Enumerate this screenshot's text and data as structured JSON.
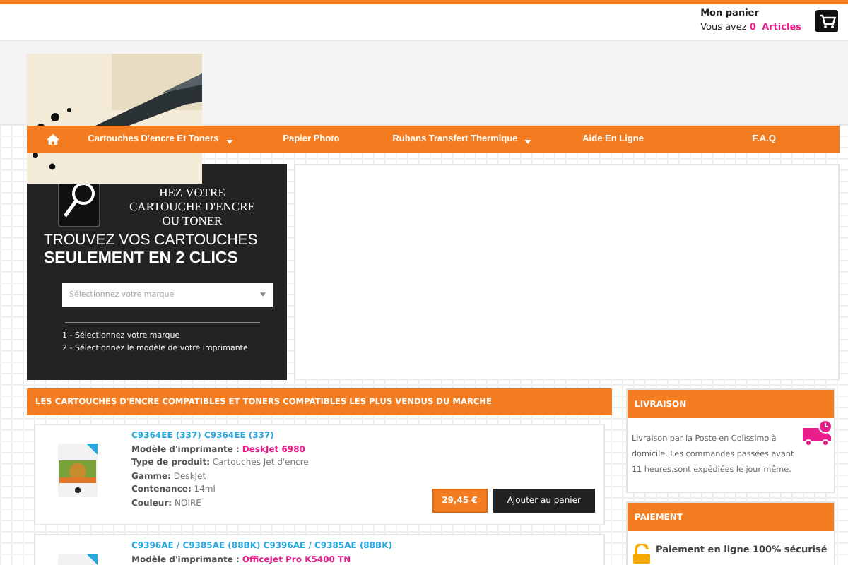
{
  "cart": {
    "title": "Mon panier",
    "prefix": "Vous avez",
    "count": "0",
    "label": "Articles"
  },
  "nav": {
    "items": [
      {
        "kind": "home"
      },
      {
        "kind": "link",
        "label": "Cartouches D'encre Et Toners",
        "dropdown": true
      },
      {
        "kind": "link",
        "label": "Papier Photo",
        "dropdown": false
      },
      {
        "kind": "link",
        "label": "Rubans Transfert Thermique",
        "dropdown": true
      },
      {
        "kind": "link",
        "label": "Aide En Ligne",
        "dropdown": false
      },
      {
        "kind": "link",
        "label": "F.A.Q",
        "dropdown": false
      }
    ]
  },
  "finder": {
    "heading_lines": [
      "HEZ VOTRE",
      "CARTOUCHE D'ENCRE",
      "OU TONER"
    ],
    "title": "TROUVEZ VOS CARTOUCHES",
    "subtitle": "SEULEMENT EN 2 CLICS",
    "select": {
      "placeholder": "Sélectionnez votre marque"
    },
    "steps": [
      "1 - Sélectionnez votre marque",
      "2 - Sélectionnez le modèle de votre imprimante"
    ]
  },
  "bestsellers": {
    "title": "LES CARTOUCHES D'ENCRE COMPATIBLES ET TONERS COMPATIBLES LES PLUS VENDUS DU MARCHE",
    "products": [
      {
        "name": "C9364EE (337) C9364EE (337)",
        "fields": [
          {
            "label": "Modèle d'imprimante :",
            "value": "DeskJet 6980",
            "kind": "highlight"
          },
          {
            "label": "Type de produit:",
            "value": "Cartouches Jet d'encre",
            "kind": "plain"
          },
          {
            "label": "Gamme:",
            "value": "DeskJet",
            "kind": "plain"
          },
          {
            "label": "Contenance:",
            "value": "14ml",
            "kind": "plain"
          },
          {
            "label": "Couleur:",
            "value": "NOIRE",
            "kind": "plain"
          }
        ],
        "price": "29,45 €",
        "button": "Ajouter au panier"
      },
      {
        "name": "C9396AE / C9385AE (88BK) C9396AE / C9385AE (88BK)",
        "fields": [
          {
            "label": "Modèle d'imprimante :",
            "value": "OfficeJet Pro K5400 TN",
            "kind": "highlight"
          }
        ]
      }
    ]
  },
  "sidebar": [
    {
      "kind": "delivery",
      "title": "LIVRAISON",
      "text": "Livraison par la Poste en Colissimo à domicile. Les commandes passées avant 11 heures,sont expédiées le jour même."
    },
    {
      "kind": "payment",
      "title": "PAIEMENT",
      "text": "Paiement en ligne 100% sécurisé"
    }
  ]
}
